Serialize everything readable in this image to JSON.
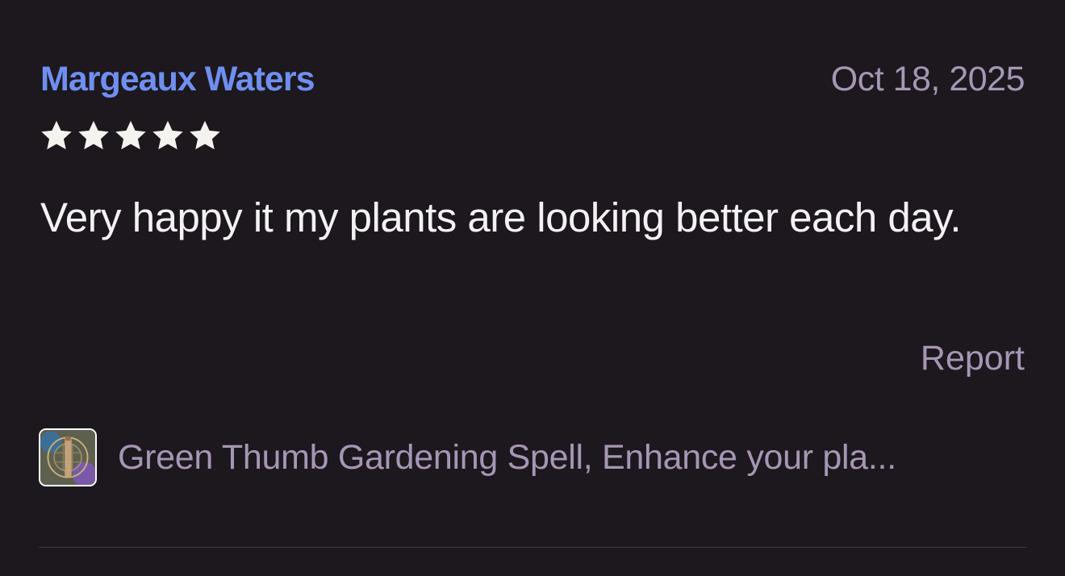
{
  "review": {
    "reviewer_name": "Margeaux Waters",
    "date": "Oct 18, 2025",
    "rating": 5,
    "rating_max": 5,
    "text": "Very happy it my plants are looking better each day.",
    "report_label": "Report"
  },
  "listing": {
    "title": "Green Thumb Gardening Spell, Enhance your pla..."
  },
  "colors": {
    "background": "#1c181e",
    "reviewer_name": "#6f8ff0",
    "muted": "#a696b4",
    "body_text": "#f4f1f4",
    "star": "#f5f3ee"
  }
}
